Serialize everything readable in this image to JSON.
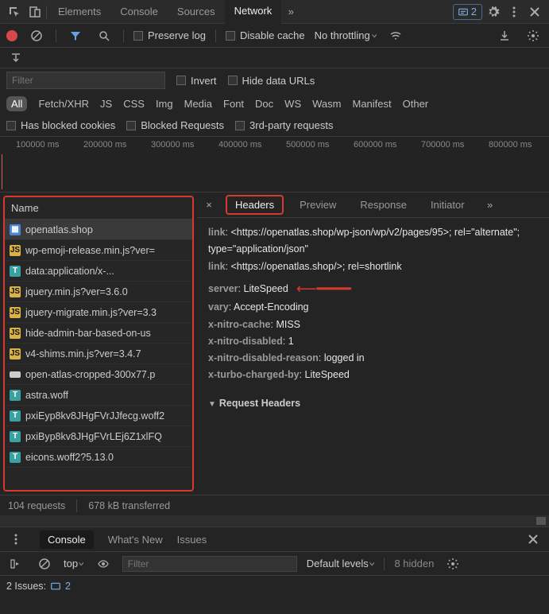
{
  "toolbar": {
    "tabs": [
      "Elements",
      "Console",
      "Sources",
      "Network"
    ],
    "active_tab": "Network",
    "issues_badge": "2"
  },
  "network_toolbar": {
    "preserve_log": "Preserve log",
    "disable_cache": "Disable cache",
    "throttling": "No throttling"
  },
  "filter_row": {
    "filter_placeholder": "Filter",
    "invert": "Invert",
    "hide_data_urls": "Hide data URLs"
  },
  "types": [
    "All",
    "Fetch/XHR",
    "JS",
    "CSS",
    "Img",
    "Media",
    "Font",
    "Doc",
    "WS",
    "Wasm",
    "Manifest",
    "Other"
  ],
  "types_active": "All",
  "extra_filters": {
    "blocked_cookies": "Has blocked cookies",
    "blocked_requests": "Blocked Requests",
    "third_party": "3rd-party requests"
  },
  "timeline_ticks": [
    "100000 ms",
    "200000 ms",
    "300000 ms",
    "400000 ms",
    "500000 ms",
    "600000 ms",
    "700000 ms",
    "800000 ms"
  ],
  "request_list": {
    "header": "Name",
    "items": [
      {
        "icon": "doc",
        "name": "openatlas.shop",
        "sel": true
      },
      {
        "icon": "js",
        "name": "wp-emoji-release.min.js?ver="
      },
      {
        "icon": "txt",
        "name": "data:application/x-..."
      },
      {
        "icon": "js",
        "name": "jquery.min.js?ver=3.6.0"
      },
      {
        "icon": "js",
        "name": "jquery-migrate.min.js?ver=3.3"
      },
      {
        "icon": "js",
        "name": "hide-admin-bar-based-on-us"
      },
      {
        "icon": "js",
        "name": "v4-shims.min.js?ver=3.4.7"
      },
      {
        "icon": "img",
        "name": "open-atlas-cropped-300x77.p"
      },
      {
        "icon": "txt",
        "name": "astra.woff"
      },
      {
        "icon": "txt",
        "name": "pxiEyp8kv8JHgFVrJJfecg.woff2"
      },
      {
        "icon": "txt",
        "name": "pxiByp8kv8JHgFVrLEj6Z1xlFQ"
      },
      {
        "icon": "txt",
        "name": "eicons.woff2?5.13.0"
      }
    ]
  },
  "detail_tabs": [
    "Headers",
    "Preview",
    "Response",
    "Initiator"
  ],
  "detail_active": "Headers",
  "response_headers": {
    "link1_label": "link",
    "link1_value": "<https://openatlas.shop/wp-json/wp/v2/pages/95>; rel=\"alternate\"; type=\"application/json\"",
    "link2_label": "link",
    "link2_value": "<https://openatlas.shop/>; rel=shortlink",
    "server_label": "server",
    "server_value": "LiteSpeed",
    "vary_label": "vary",
    "vary_value": "Accept-Encoding",
    "xnc_label": "x-nitro-cache",
    "xnc_value": "MISS",
    "xnd_label": "x-nitro-disabled",
    "xnd_value": "1",
    "xndr_label": "x-nitro-disabled-reason",
    "xndr_value": "logged in",
    "xturbo_label": "x-turbo-charged-by",
    "xturbo_value": "LiteSpeed"
  },
  "request_headers_title": "Request Headers",
  "status": {
    "requests": "104 requests",
    "transferred": "678 kB transferred"
  },
  "drawer": {
    "tabs": [
      "Console",
      "What's New",
      "Issues"
    ],
    "active": "Console",
    "scope": "top",
    "filter_placeholder": "Filter",
    "levels": "Default levels",
    "hidden": "8 hidden",
    "issues_label": "2 Issues:",
    "issues_count": "2"
  }
}
